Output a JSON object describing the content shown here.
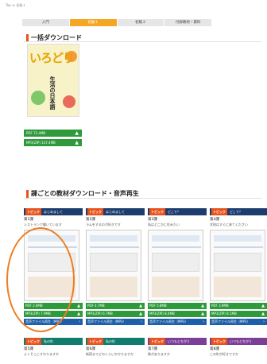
{
  "breadcrumb": "Top ≫ 初級１",
  "tabs": [
    {
      "label": "入門"
    },
    {
      "label": "初級１"
    },
    {
      "label": "初級２"
    },
    {
      "label": "付録教材・資料"
    }
  ],
  "sections": {
    "bulk": "一括ダウンロード",
    "lessons": "課ごとの教材ダウンロード・音声再生"
  },
  "cover": {
    "big": "いろどり",
    "sub": "生活の日本語"
  },
  "bulk_buttons": [
    {
      "label": "PDF 72.4MB"
    },
    {
      "label": "MP3(ZIP) 137.4MB"
    }
  ],
  "lessons": [
    {
      "topic": "トピック",
      "theme": "はじめまして",
      "num": "第1課",
      "desc": "レストランで働いています",
      "buttons": [
        "PDF 2.6MB",
        "MP3(ZIP) 7.9MB",
        "音声ファイル再生（MP3）"
      ]
    },
    {
      "topic": "トピック",
      "theme": "はじめまして",
      "num": "第2課",
      "desc": "ラムをするのが好きです",
      "buttons": [
        "PDF 4.7MB",
        "MP3(ZIP) 6.7MB",
        "音声ファイル再生（MP3）"
      ]
    },
    {
      "topic": "トピック",
      "theme": "どこで？",
      "num": "第3課",
      "desc": "私はどこかに住みたい",
      "buttons": [
        "PDF 5.8MB",
        "MP3(ZIP) 8.4MB",
        "音声ファイル再生（MP3）"
      ]
    },
    {
      "topic": "トピック",
      "theme": "どこで？",
      "num": "第4課",
      "desc": "学校はすぐに来てください",
      "buttons": [
        "PDF 3.9MB",
        "MP3(ZIP) 8.1MB",
        "音声ファイル再生（MP3）"
      ]
    }
  ],
  "lessons2": [
    {
      "topic": "トピック",
      "theme": "私の町",
      "num": "第5課",
      "desc": "よくそこにすわりますか"
    },
    {
      "topic": "トピック",
      "theme": "私の町",
      "num": "第6課",
      "desc": "新宿までどのくらいかかりますか"
    },
    {
      "topic": "トピック",
      "theme": "いつもとちがう",
      "num": "第7課",
      "desc": "熱がありますか"
    },
    {
      "topic": "トピック",
      "theme": "いつもとちがう",
      "num": "第8課",
      "desc": "この町が好きですか"
    }
  ]
}
